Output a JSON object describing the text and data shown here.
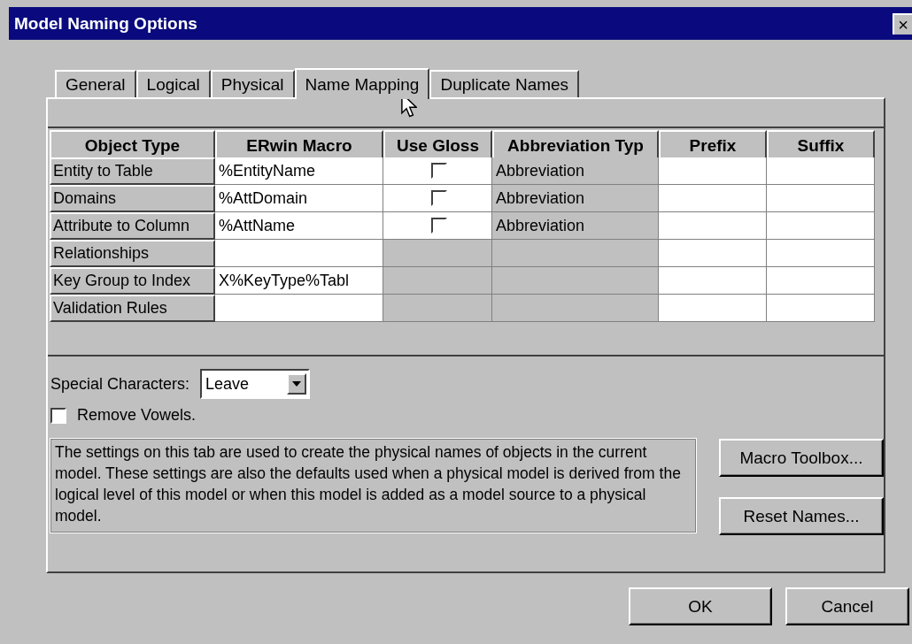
{
  "window": {
    "title": "Model Naming Options",
    "close": "×"
  },
  "tabs": [
    {
      "label": "General",
      "selected": false
    },
    {
      "label": "Logical",
      "selected": false
    },
    {
      "label": "Physical",
      "selected": false
    },
    {
      "label": "Name Mapping",
      "selected": true
    },
    {
      "label": "Duplicate Names",
      "selected": false
    }
  ],
  "table": {
    "columns": [
      "Object Type",
      "ERwin Macro",
      "Use Gloss",
      "Abbreviation Typ",
      "Prefix",
      "Suffix"
    ],
    "rows": [
      {
        "object_type": "Entity to Table",
        "macro": "%EntityName",
        "use_gloss": {
          "checked": false
        },
        "abbreviation_type": "Abbreviation"
      },
      {
        "object_type": "Domains",
        "macro": "%AttDomain",
        "use_gloss": {
          "checked": false
        },
        "abbreviation_type": "Abbreviation"
      },
      {
        "object_type": "Attribute to Column",
        "macro": "%AttName",
        "use_gloss": {
          "checked": false
        },
        "abbreviation_type": "Abbreviation"
      },
      {
        "object_type": "Relationships"
      },
      {
        "object_type": "Key Group to Index",
        "macro": "X%KeyType%Tabl"
      },
      {
        "object_type": "Validation Rules"
      }
    ]
  },
  "special_characters": {
    "label": "Special Characters:",
    "value": "Leave"
  },
  "remove_vowels": {
    "label": "Remove Vowels.",
    "checked": false
  },
  "description": "The settings on this tab are used to create the physical names of objects in the current model. These settings are also the defaults used when a physical model is derived from the logical level of this model or when this model is added as a model source to a physical model.",
  "side_buttons": [
    "Macro Toolbox...",
    "Reset Names..."
  ],
  "buttons": [
    "OK",
    "Cancel"
  ]
}
